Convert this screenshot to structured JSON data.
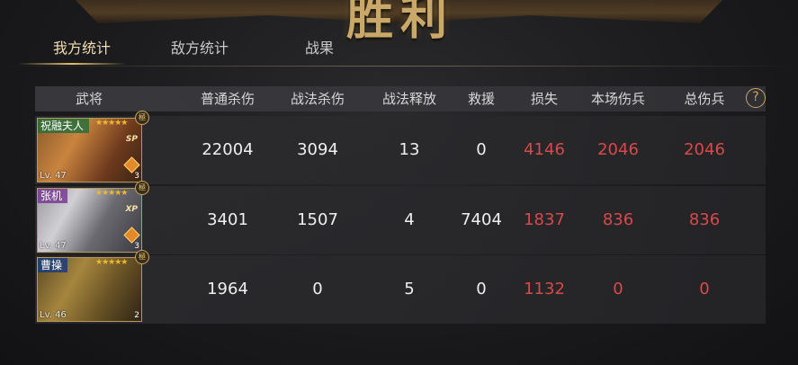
{
  "title": "胜利",
  "tabs": [
    {
      "label": "我方统计",
      "active": true
    },
    {
      "label": "敌方统计",
      "active": false
    },
    {
      "label": "战果",
      "active": false
    }
  ],
  "columns": [
    "武将",
    "普通杀伤",
    "战法杀伤",
    "战法释放",
    "救援",
    "损失",
    "本场伤兵",
    "总伤兵"
  ],
  "help_label": "?",
  "rows": [
    {
      "name": "祝融夫人",
      "level": "Lv. 47",
      "stars": "★★★★★",
      "tag": "SP",
      "badge": "3",
      "corner": "極",
      "normal_damage": "22004",
      "tactic_damage": "3094",
      "tactic_casts": "13",
      "rescue": "0",
      "loss": "4146",
      "wounded_this_battle": "2046",
      "total_wounded": "2046"
    },
    {
      "name": "张机",
      "level": "Lv. 47",
      "stars": "★★★★★",
      "tag": "XP",
      "badge": "3",
      "corner": "極",
      "normal_damage": "3401",
      "tactic_damage": "1507",
      "tactic_casts": "4",
      "rescue": "7404",
      "loss": "1837",
      "wounded_this_battle": "836",
      "total_wounded": "836"
    },
    {
      "name": "曹操",
      "level": "Lv. 46",
      "stars": "★★★★★",
      "tag": "",
      "badge": "2",
      "corner": "極",
      "normal_damage": "1964",
      "tactic_damage": "0",
      "tactic_casts": "5",
      "rescue": "0",
      "loss": "1132",
      "wounded_this_battle": "0",
      "total_wounded": "0"
    }
  ],
  "colors": {
    "accent_gold": "#c9a869",
    "loss_red": "#d64a4a",
    "tab_active": "#f2dfb2"
  }
}
